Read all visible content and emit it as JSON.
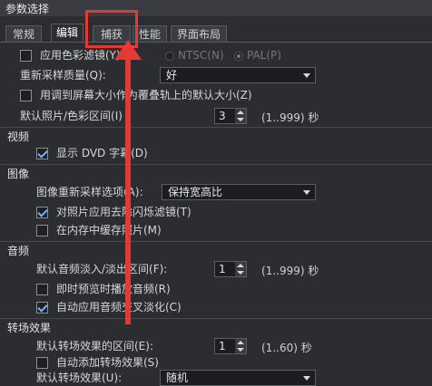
{
  "window": {
    "title": "参数选择"
  },
  "tabs": [
    {
      "label": "常规"
    },
    {
      "label": "编辑"
    },
    {
      "label": "捕获"
    },
    {
      "label": "性能"
    },
    {
      "label": "界面布局"
    }
  ],
  "general": {
    "color_filter_label": "应用色彩滤镜(Y):",
    "ntsc_label": "NTSC(N)",
    "pal_label": "PAL(P)",
    "resample_label": "重新采样质量(Q):",
    "resample_value": "好",
    "fit_overlay_label": "用调到屏幕大小作为覆叠轨上的默认大小(Z)",
    "default_photo_label": "默认照片/色彩区间(I)",
    "default_photo_value": "3",
    "default_photo_range": "(1..999) 秒"
  },
  "video": {
    "section": "视频",
    "show_dvd_label": "显示 DVD 字幕(D)"
  },
  "image": {
    "section": "图像",
    "resample_option_label": "图像重新采样选项(A):",
    "resample_option_value": "保持宽高比",
    "deflicker_label": "对照片应用去除闪烁滤镜(T)",
    "cache_label": "在内存中缓存照片(M)"
  },
  "audio": {
    "section": "音频",
    "fade_label": "默认音频淡入/淡出区间(F):",
    "fade_value": "1",
    "fade_range": "(1..999) 秒",
    "preview_label": "即时预览时播放音频(R)",
    "crossfade_label": "自动应用音频交叉淡化(C)"
  },
  "transition": {
    "section": "转场效果",
    "duration_label": "默认转场效果的区间(E):",
    "duration_value": "1",
    "duration_range": "(1..60) 秒",
    "auto_add_label": "自动添加转场效果(S)",
    "default_effect_label": "默认转场效果(U):",
    "default_effect_value": "随机"
  },
  "colors": {
    "annotation": "#e53935",
    "check": "#6fb7ff"
  }
}
